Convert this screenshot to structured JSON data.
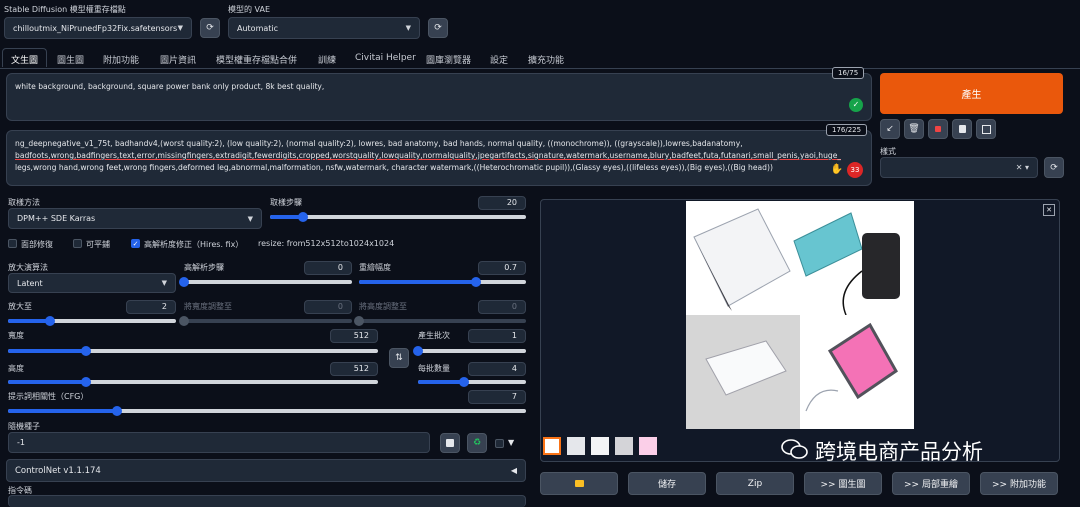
{
  "header": {
    "model_label": "Stable Diffusion 模型權重存檔點",
    "model_value": "chilloutmix_NiPrunedFp32Fix.safetensors",
    "vae_label": "模型的 VAE",
    "vae_value": "Automatic"
  },
  "tabs": [
    "文生圖",
    "圖生圖",
    "附加功能",
    "圖片資訊",
    "模型權重存檔點合併",
    "訓練",
    "Civitai Helper",
    "圖庫瀏覽器",
    "設定",
    "擴充功能"
  ],
  "prompt": {
    "text": "white background,  background, square power bank only product, 8k best quality,",
    "counter": "16/75"
  },
  "negative": {
    "line1": "ng_deepnegative_v1_75t, badhandv4,(worst quality:2), (low quality:2), (normal quality:2), lowres, bad anatomy, bad hands, normal quality, ((monochrome)), ((grayscale)),lowres,badanatomy,",
    "line2": "badfoots,wrong,badfingers,text,error,missingfingers,extradigit,fewerdigits,cropped,worstquality,lowquality,normalquality,jpegartifacts,signature,watermark,username,blury,badfeet,futa,futanari,small_penis,yaoi,huge_breasts,large_breasts,three",
    "line3": "legs,wrong hand,wrong feet,wrong fingers,deformed leg,abnormal,malformation, nsfw,watermark, character watermark,((Heterochromatic pupil)),(Glassy eyes),((lifeless eyes)),(Big eyes),((Big head))",
    "counter": "176/225",
    "badge": "33"
  },
  "generate_label": "產生",
  "styles_label": "樣式",
  "sampling": {
    "method_label": "取樣方法",
    "method_value": "DPM++ SDE Karras",
    "steps_label": "取樣步驟",
    "steps_value": "20",
    "steps_fraction": 0.13
  },
  "checks": {
    "face_restore": "面部修復",
    "tiling": "可平鋪",
    "hires": "高解析度修正（Hires. fix）",
    "resize": "resize: from512x512to1024x1024"
  },
  "hires": {
    "upscaler_label": "放大演算法",
    "upscaler_value": "Latent",
    "steps_label": "高解析步驟",
    "steps_value": "0",
    "steps_fraction": 0.0,
    "denoise_label": "重繪幅度",
    "denoise_value": "0.7",
    "denoise_fraction": 0.7,
    "scale_label": "放大至",
    "scale_value": "2",
    "scale_fraction": 0.25,
    "width_label": "將寬度調整至",
    "width_value": "0",
    "height_label": "將高度調整至",
    "height_value": "0"
  },
  "size": {
    "width_label": "寬度",
    "width_value": "512",
    "width_fraction": 0.21,
    "height_label": "高度",
    "height_value": "512",
    "height_fraction": 0.21,
    "batch_count_label": "產生批次",
    "batch_count_value": "1",
    "batch_count_fraction": 0.0,
    "batch_size_label": "每批數量",
    "batch_size_value": "4",
    "batch_size_fraction": 0.43,
    "cfg_label": "提示詞相關性（CFG）",
    "cfg_value": "7",
    "cfg_fraction": 0.21
  },
  "seed": {
    "label": "隨機種子",
    "value": "-1"
  },
  "controlnet_label": "ControlNet v1.1.174",
  "script_label": "指令碼",
  "actions": [
    "儲存",
    "Zip",
    ">> 圖生圖",
    ">> 局部重繪",
    ">> 附加功能"
  ],
  "watermark": "跨境电商产品分析",
  "colors": {
    "accent": "#2563eb",
    "generate": "#ea580c",
    "bg": "#0b0f19"
  }
}
